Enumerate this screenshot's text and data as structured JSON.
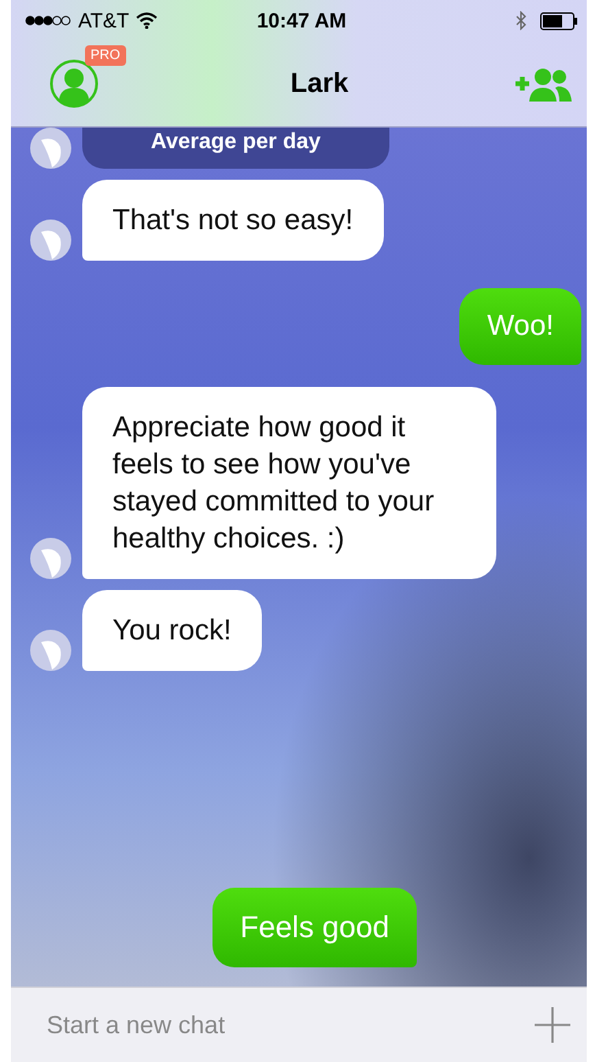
{
  "status_bar": {
    "carrier": "AT&T",
    "time": "10:47 AM"
  },
  "nav_bar": {
    "badge": "PRO",
    "title": "Lark"
  },
  "messages": [
    {
      "kind": "card",
      "text": "Average per day"
    },
    {
      "kind": "received",
      "text": "That's not so easy!"
    },
    {
      "kind": "sent",
      "text": "Woo!"
    },
    {
      "kind": "received",
      "text": "Appreciate how good it feels to see how you've stayed committed to your healthy choices. :)"
    },
    {
      "kind": "received",
      "text": "You rock!"
    },
    {
      "kind": "reply_option",
      "text": "Feels good"
    }
  ],
  "composer": {
    "placeholder": "Start a new chat"
  }
}
